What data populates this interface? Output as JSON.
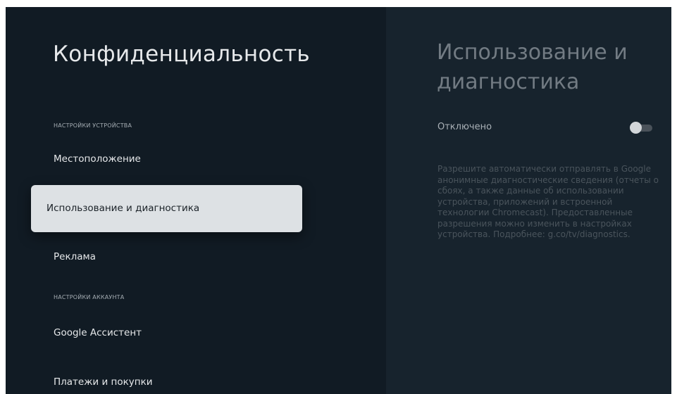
{
  "left_panel": {
    "title": "Конфиденциальность",
    "sections": [
      {
        "header": "НАСТРОЙКИ УСТРОЙСТВА",
        "items": [
          {
            "label": "Местоположение",
            "focused": false
          },
          {
            "label": "Использование и диагностика",
            "focused": true
          },
          {
            "label": "Реклама",
            "focused": false
          }
        ]
      },
      {
        "header": "НАСТРОЙКИ АККАУНТА",
        "items": [
          {
            "label": "Google Ассистент",
            "focused": false
          },
          {
            "label": "Платежи и покупки",
            "focused": false
          }
        ]
      }
    ]
  },
  "right_panel": {
    "title": "Использование и диагностика",
    "toggle_label": "Отключено",
    "toggle_on": false,
    "description": "Разрешите автоматически отправлять в Google анонимные диагностические сведения (отчеты о сбоях, а также данные об использовании устройства, приложений и встроенной технологии Chromecast). Предоставленные разрешения можно изменить в настройках устройства. Подробнее: g.co/tv/diagnostics."
  },
  "colors": {
    "background": "#111b24",
    "detail_panel": "#17232d",
    "focus_card": "#dde1e4",
    "text_primary": "#e6e8ea",
    "text_dim": "#727b83"
  }
}
